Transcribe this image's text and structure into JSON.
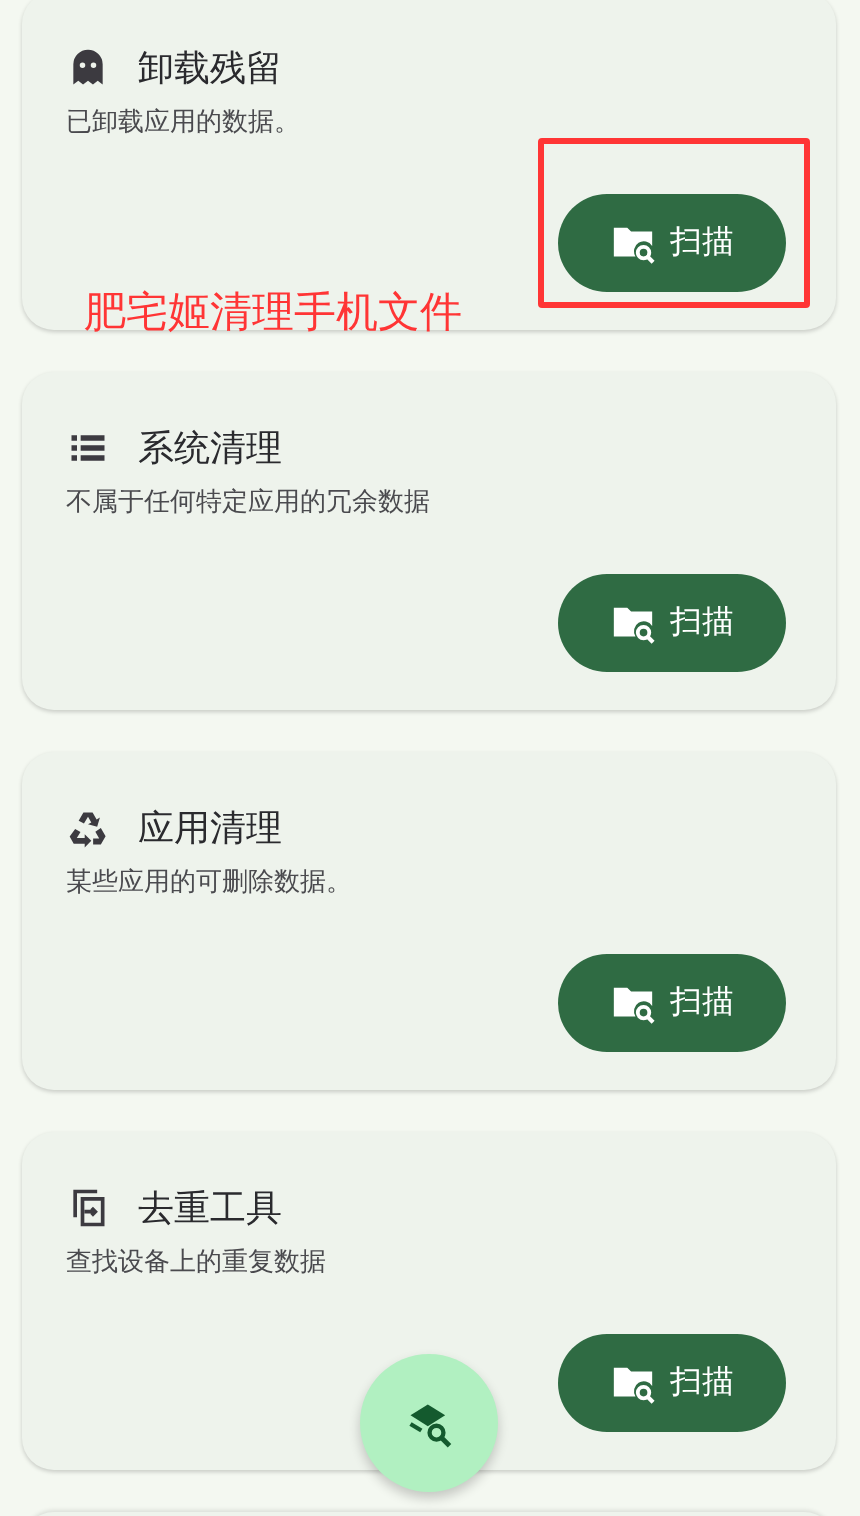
{
  "cards": [
    {
      "title": "卸载残留",
      "description": "已卸载应用的数据。",
      "button": "扫描"
    },
    {
      "title": "系统清理",
      "description": "不属于任何特定应用的冗余数据",
      "button": "扫描"
    },
    {
      "title": "应用清理",
      "description": "某些应用的可删除数据。",
      "button": "扫描"
    },
    {
      "title": "去重工具",
      "description": "查找设备上的重复数据",
      "button": "扫描"
    }
  ],
  "next_card_peek": true,
  "annotation": {
    "text": "肥宅姬清理手机文件"
  },
  "fab": {
    "kind": "scan"
  }
}
